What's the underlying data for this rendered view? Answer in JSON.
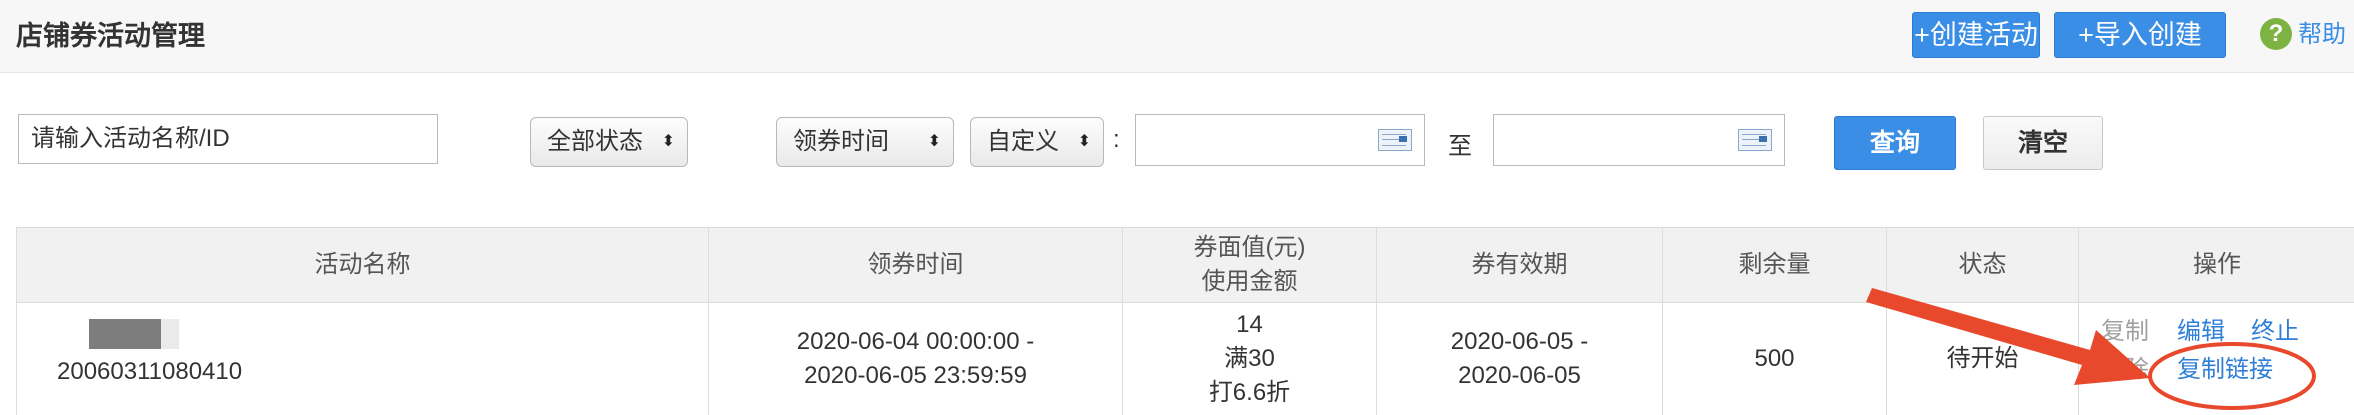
{
  "header": {
    "title": "店铺券活动管理",
    "create_button": "+创建活动",
    "import_button": "+导入创建",
    "help_label": "帮助"
  },
  "filters": {
    "search_value": "请输入活动名称/ID",
    "status_select": "全部状态",
    "time_type_select": "领券时间",
    "range_select": "自定义",
    "colon": ":",
    "date_from": "",
    "to_label": "至",
    "date_to": "",
    "query_button": "查询",
    "clear_button": "清空"
  },
  "table": {
    "headers": {
      "name": "活动名称",
      "claim_time": "领券时间",
      "face_value_line1": "券面值(元)",
      "face_value_line2": "使用金额",
      "validity": "券有效期",
      "remaining": "剩余量",
      "status": "状态",
      "actions": "操作"
    },
    "rows": [
      {
        "name_id": "20060311080410",
        "claim_start": "2020-06-04 00:00:00 -",
        "claim_end": "2020-06-05 23:59:59",
        "face_value": "14",
        "threshold": "满30",
        "discount": "打6.6折",
        "valid_start": "2020-06-05 -",
        "valid_end": "2020-06-05",
        "remaining": "500",
        "status": "待开始",
        "actions": {
          "copy": "复制",
          "edit": "编辑",
          "stop": "终止",
          "delete": "删除",
          "copy_link": "复制链接"
        }
      }
    ]
  },
  "colors": {
    "primary": "#3a8ee6",
    "link": "#2f7fd8",
    "annotation": "#e8492c",
    "help_icon": "#7cb342"
  },
  "icons": {
    "help": "question-circle-icon",
    "calendar": "calendar-icon",
    "select_arrows": "up-down-arrows-icon"
  }
}
